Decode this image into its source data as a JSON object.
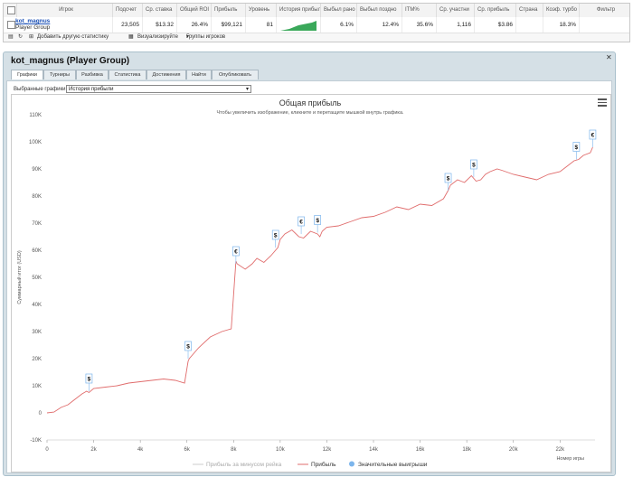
{
  "table": {
    "headers": [
      "Игрок",
      "Подсчет",
      "Ср. ставка",
      "Общий ROI",
      "Прибыль",
      "Уровень",
      "История прибыли",
      "Выбыл рано",
      "Выбыл поздно",
      "ITM%",
      "Ср. участни",
      "Ср. прибыль",
      "Страна",
      "Коэф. турбо",
      "Фильтр"
    ],
    "row": {
      "player_name": "kot_magnus",
      "player_group": "Player Group",
      "count": "23,505",
      "avg_stake": "$13.32",
      "roi": "26.4%",
      "profit": "$99,121",
      "level": "81",
      "early_exit": "6.1%",
      "late_exit": "12.4%",
      "itm": "35.6%",
      "avg_entrants": "1,116",
      "avg_profit": "$3.86",
      "country": "",
      "turbo": "18.3%"
    },
    "toolbar": {
      "add_stat": "Добавить другую статистику",
      "visualize": "Визуализируйте",
      "groups": "Группы игроков"
    }
  },
  "panel": {
    "title": "kot_magnus (Player Group)",
    "tabs": [
      "Графики",
      "Турниры",
      "Разбивка",
      "Статистика",
      "Достижения",
      "Найти",
      "Опубликовать"
    ],
    "active_tab": "Графики",
    "select_label": "Выбранные графики:",
    "select_value": "История прибыли"
  },
  "chart_data": {
    "type": "line",
    "title": "Общая прибыль",
    "subtitle": "Чтобы увеличить изображение, кликните и перетащите мышкой внутрь графика.",
    "ylabel": "Суммарный итог (USD)",
    "xlabel": "Номер игры",
    "ylim": [
      -10000,
      110000
    ],
    "xlim": [
      0,
      23500
    ],
    "yticks": [
      "-10K",
      "0",
      "10K",
      "20K",
      "30K",
      "40K",
      "50K",
      "60K",
      "70K",
      "80K",
      "90K",
      "100K",
      "110K"
    ],
    "xticks": [
      "0",
      "2k",
      "4k",
      "6k",
      "8k",
      "10k",
      "12k",
      "14k",
      "16k",
      "18k",
      "20k",
      "22k"
    ],
    "series": [
      {
        "name": "Прибыль за минусом рейка",
        "color": "#cccccc",
        "values": []
      },
      {
        "name": "Прибыль",
        "color": "#e06c6c",
        "x": [
          0,
          300,
          600,
          900,
          1200,
          1500,
          1700,
          1800,
          2000,
          2500,
          3000,
          3500,
          4000,
          4500,
          5000,
          5500,
          5900,
          6050,
          6100,
          6500,
          7000,
          7500,
          7900,
          8100,
          8150,
          8500,
          8800,
          9000,
          9300,
          9600,
          9900,
          10000,
          10200,
          10500,
          10800,
          11000,
          11300,
          11600,
          11700,
          11800,
          12000,
          12500,
          13000,
          13500,
          14000,
          14500,
          15000,
          15500,
          16000,
          16500,
          17000,
          17200,
          17300,
          17600,
          17900,
          18200,
          18400,
          18600,
          18800,
          19000,
          19300,
          19500,
          20000,
          20500,
          21000,
          21500,
          22000,
          22300,
          22600,
          22800,
          23000,
          23300,
          23400
        ],
        "values": [
          0,
          300,
          2000,
          3000,
          5000,
          7000,
          8000,
          7500,
          9000,
          9500,
          10000,
          11000,
          11500,
          12000,
          12500,
          12000,
          11000,
          19000,
          20000,
          24000,
          28000,
          30000,
          31000,
          56000,
          55000,
          53000,
          55000,
          57000,
          55500,
          58000,
          61000,
          64000,
          66000,
          67500,
          65000,
          64500,
          67000,
          66000,
          65000,
          67000,
          68500,
          69000,
          70500,
          72000,
          72500,
          74000,
          76000,
          75000,
          77000,
          76500,
          79000,
          82000,
          84000,
          86000,
          85000,
          87500,
          85500,
          86000,
          88000,
          89000,
          90000,
          89500,
          88000,
          87000,
          86000,
          88000,
          89000,
          91000,
          93000,
          93500,
          95000,
          96000,
          98000
        ]
      },
      {
        "name": "Значительные выигрыши",
        "color": "#7cb5ec",
        "markers": [
          {
            "x": 1800,
            "y": 8000,
            "label": "$"
          },
          {
            "x": 6050,
            "y": 20000,
            "label": "$"
          },
          {
            "x": 8100,
            "y": 55000,
            "label": "€"
          },
          {
            "x": 9800,
            "y": 61000,
            "label": "$"
          },
          {
            "x": 10900,
            "y": 66000,
            "label": "€"
          },
          {
            "x": 11600,
            "y": 66500,
            "label": "$"
          },
          {
            "x": 17200,
            "y": 82000,
            "label": "$"
          },
          {
            "x": 18300,
            "y": 87000,
            "label": "$"
          },
          {
            "x": 22700,
            "y": 93500,
            "label": "$"
          },
          {
            "x": 23400,
            "y": 98000,
            "label": "€"
          }
        ]
      }
    ],
    "legend": "bottom-center",
    "grid": false
  }
}
